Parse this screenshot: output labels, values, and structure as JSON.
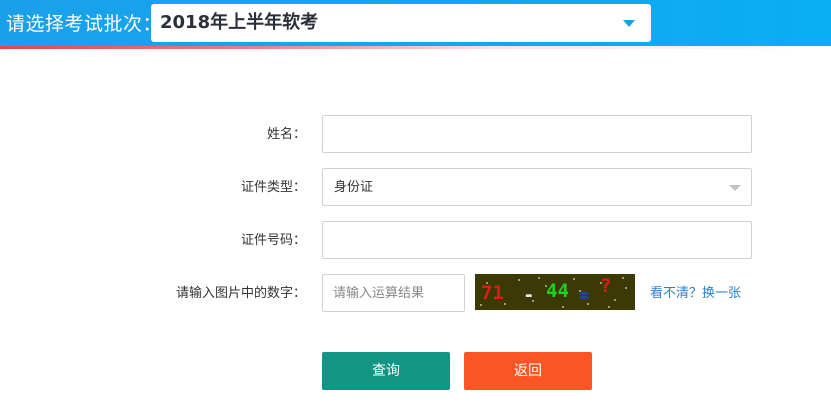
{
  "header": {
    "batch_label": "请选择考试批次：",
    "batch_selected": "2018年上半年软考",
    "colors": {
      "bar": "#14a7ee",
      "accent_line": "#e8434b",
      "caret": "#1c9fe5"
    }
  },
  "form": {
    "name_label": "姓名：",
    "name_value": "",
    "id_type_label": "证件类型：",
    "id_type_selected": "身份证",
    "id_number_label": "证件号码：",
    "id_number_value": "",
    "captcha_label": "请输入图片中的数字：",
    "captcha_placeholder": "请输入运算结果",
    "captcha_image": {
      "expression": [
        "71",
        "-",
        "44",
        "=",
        "?"
      ],
      "colors": [
        "#e01a1a",
        "#e8e8e8",
        "#22d01f",
        "#1e3fd8",
        "#e01a1a"
      ],
      "background": "#3b3a05"
    },
    "captcha_refresh": "看不清？换一张"
  },
  "actions": {
    "query_label": "查询",
    "back_label": "返回",
    "colors": {
      "query": "#139586",
      "back": "#fb5525"
    }
  }
}
